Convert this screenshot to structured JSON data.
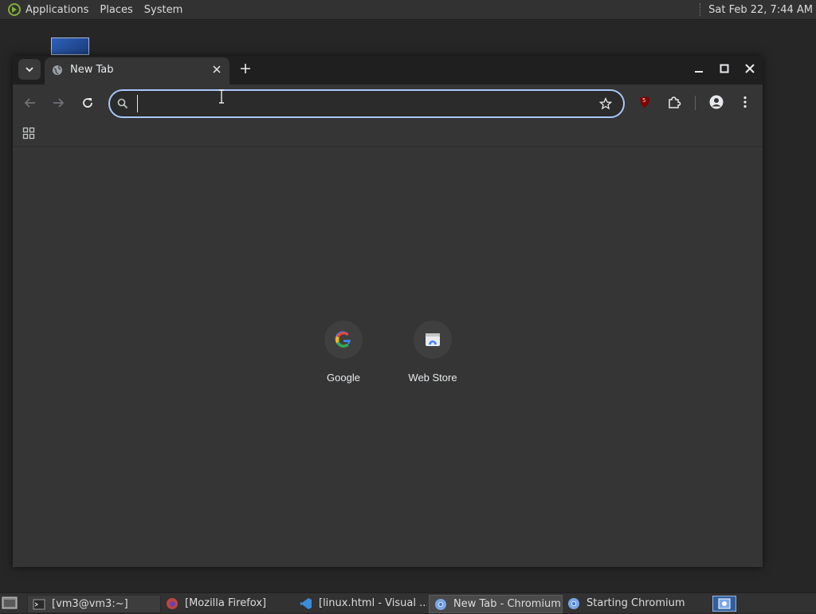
{
  "top_panel": {
    "menus": [
      "Applications",
      "Places",
      "System"
    ],
    "clock": "Sat Feb 22,  7:44 AM"
  },
  "browser": {
    "tab_title": "New Tab",
    "omnibox_value": "",
    "extension_badge": "5",
    "shortcuts": [
      {
        "label": "Google",
        "icon": "google-g-icon"
      },
      {
        "label": "Web Store",
        "icon": "web-store-icon"
      }
    ],
    "accent": "#a8c7fa"
  },
  "taskbar": {
    "items": [
      {
        "label": "[vm3@vm3:~]",
        "icon": "terminal-icon"
      },
      {
        "label": "[Mozilla Firefox]",
        "icon": "firefox-icon"
      },
      {
        "label": "[linux.html - Visual ...",
        "icon": "vscode-icon"
      },
      {
        "label": "New Tab - Chromium",
        "icon": "chromium-icon"
      },
      {
        "label": "Starting Chromium",
        "icon": "chromium-icon"
      }
    ]
  }
}
